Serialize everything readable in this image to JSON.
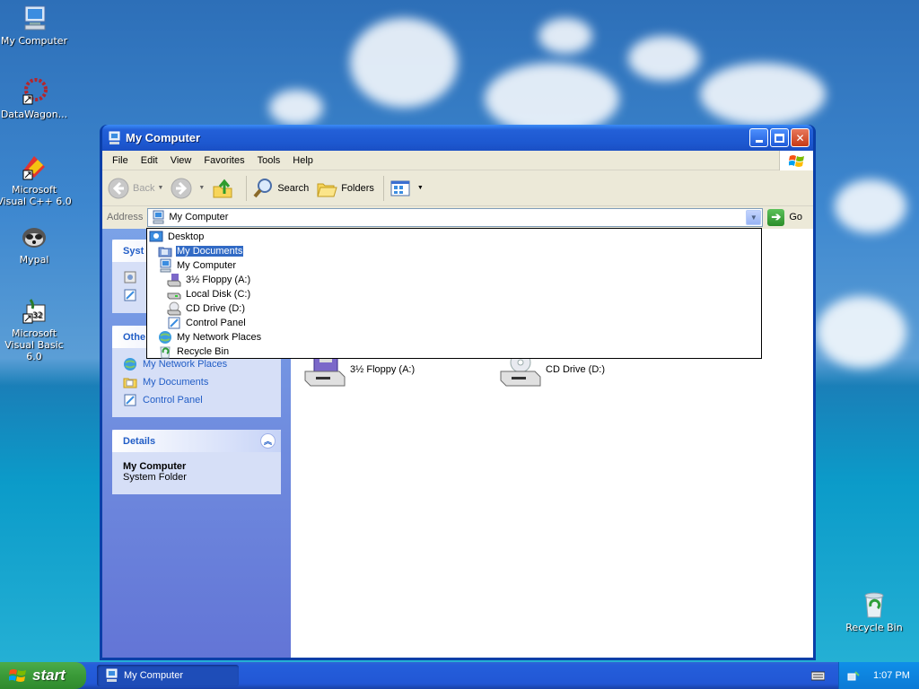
{
  "desktop": {
    "icons": [
      {
        "label": "My Computer",
        "icon": "my-computer-icon"
      },
      {
        "label": "DataWagon...",
        "icon": "datawagon-icon"
      },
      {
        "label": "Microsoft Visual C++ 6.0",
        "icon": "visual-cpp-icon"
      },
      {
        "label": "Mypal",
        "icon": "mypal-icon"
      },
      {
        "label": "Microsoft Visual Basic 6.0",
        "icon": "visual-basic-icon"
      },
      {
        "label": "Recycle Bin",
        "icon": "recycle-bin-icon"
      }
    ]
  },
  "window": {
    "title": "My Computer",
    "menu": [
      "File",
      "Edit",
      "View",
      "Favorites",
      "Tools",
      "Help"
    ],
    "toolbar": {
      "back": "Back",
      "search": "Search",
      "folders": "Folders"
    },
    "address": {
      "label": "Address",
      "value": "My Computer",
      "go": "Go"
    },
    "dropdown": [
      {
        "label": "Desktop",
        "icon": "desktop-icon",
        "indent": 0
      },
      {
        "label": "My Documents",
        "icon": "my-documents-icon",
        "indent": 1,
        "selected": true
      },
      {
        "label": "My Computer",
        "icon": "my-computer-icon",
        "indent": 1
      },
      {
        "label": "3½ Floppy (A:)",
        "icon": "floppy-icon",
        "indent": 2
      },
      {
        "label": "Local Disk (C:)",
        "icon": "local-disk-icon",
        "indent": 2
      },
      {
        "label": "CD Drive (D:)",
        "icon": "cd-drive-icon",
        "indent": 2
      },
      {
        "label": "Control Panel",
        "icon": "control-panel-icon",
        "indent": 2
      },
      {
        "label": "My Network Places",
        "icon": "network-places-icon",
        "indent": 1
      },
      {
        "label": "Recycle Bin",
        "icon": "recycle-bin-icon",
        "indent": 1
      }
    ],
    "taskpane": {
      "system_header": "Syst",
      "other_header": "Othe",
      "other_links": [
        "My Network Places",
        "My Documents",
        "Control Panel"
      ],
      "details_header": "Details",
      "details_title": "My Computer",
      "details_subtitle": "System Folder"
    },
    "content": {
      "items": [
        {
          "label": "3½ Floppy (A:)",
          "icon": "floppy-drive-icon"
        },
        {
          "label": "CD Drive (D:)",
          "icon": "cd-drive-icon"
        }
      ]
    }
  },
  "taskbar": {
    "start": "start",
    "task": "My Computer",
    "time": "1:07 PM"
  }
}
